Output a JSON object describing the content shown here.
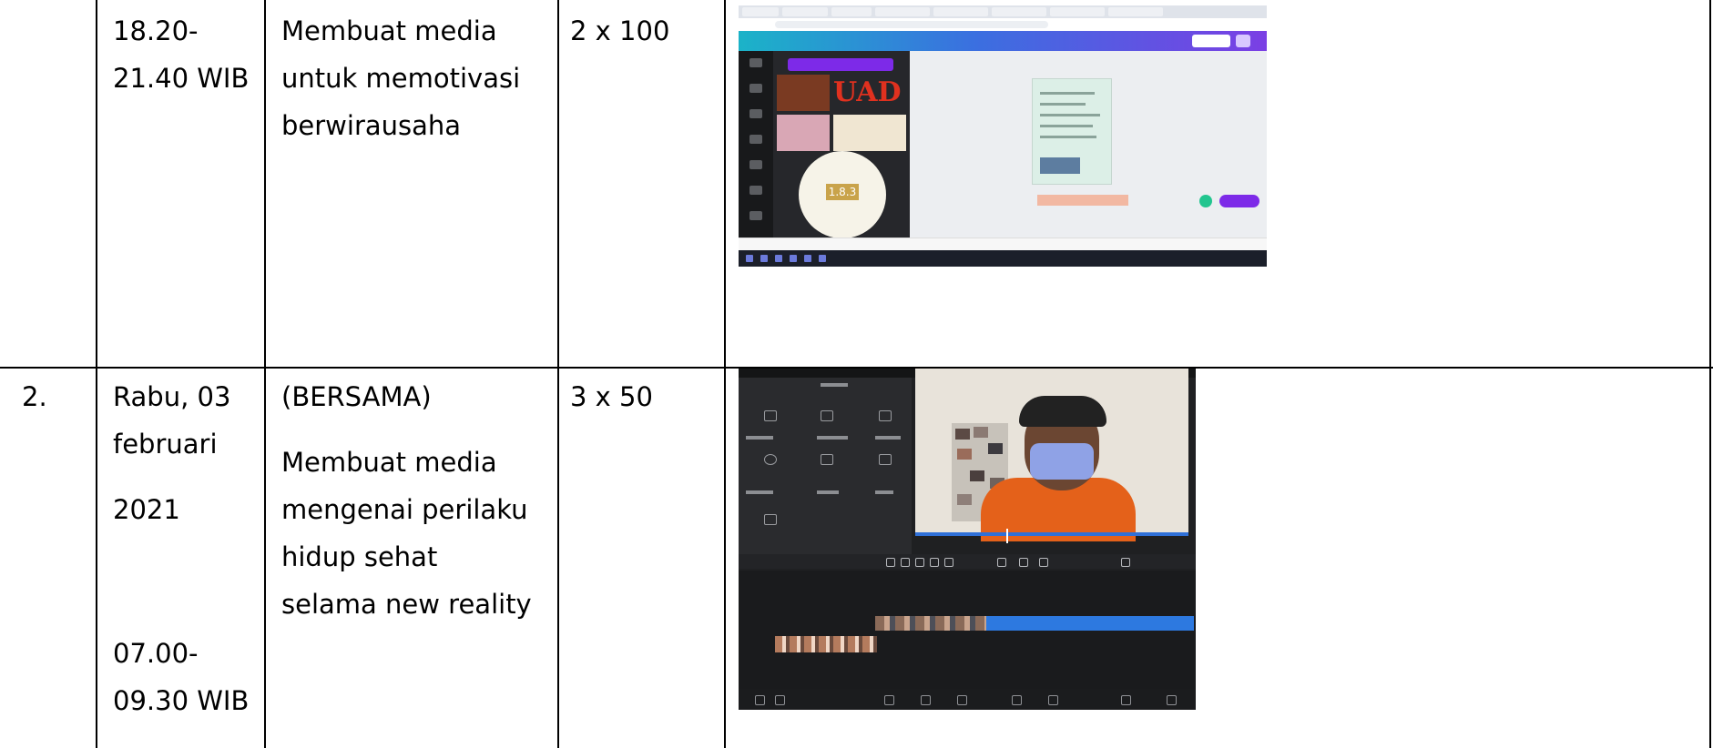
{
  "table": {
    "rows": [
      {
        "no": "",
        "time_lines": [
          "18.20-",
          "21.40 WIB"
        ],
        "activity_lines": [
          "Membuat media",
          "untuk memotivasi",
          "berwirausaha"
        ],
        "volume": "2 x 100",
        "documentation": {
          "image": "screenshot-canva-design-uad",
          "logo_text": "UAD",
          "badge_text": "1.8.3"
        }
      },
      {
        "no": "2.",
        "time_lines": [
          "Rabu, 03",
          "februari",
          "2021",
          "07.00-",
          "09.30 WIB"
        ],
        "activity_lines": [
          "(BERSAMA)",
          "Membuat media",
          "mengenai perilaku",
          "hidup sehat",
          "selama new reality"
        ],
        "volume": "3 x 50",
        "documentation": {
          "image": "photo-video-editor-masked-person"
        }
      }
    ]
  },
  "colors": {
    "border": "#000000",
    "canva_purple": "#7d2ae8",
    "uad_red": "#e0311f",
    "editor_blue": "#2d79e0",
    "jacket_orange": "#e4611a"
  }
}
